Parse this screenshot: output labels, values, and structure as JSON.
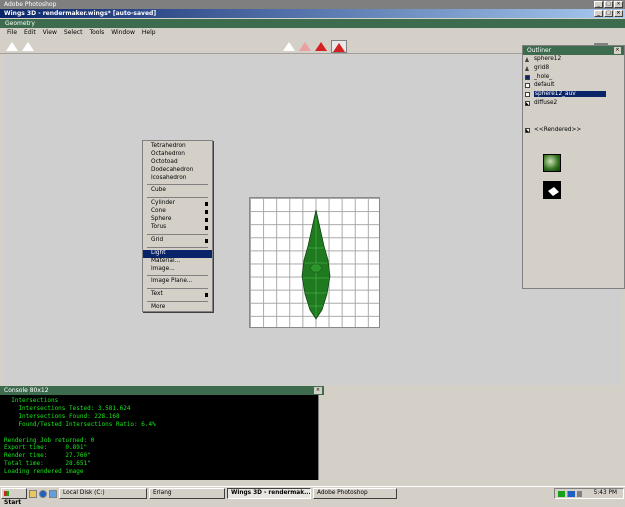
{
  "app_title": "Adobe Photoshop",
  "window_title": "Wings 3D - rendermaker.wings* [auto-saved]",
  "geometry_title": "Geometry",
  "menu": [
    "File",
    "Edit",
    "View",
    "Select",
    "Tools",
    "Window",
    "Help"
  ],
  "popup_menu": [
    {
      "label": "Tetrahedron"
    },
    {
      "label": "Octahedron"
    },
    {
      "label": "Octotoad"
    },
    {
      "label": "Dodecahedron"
    },
    {
      "label": "Icosahedron"
    },
    {
      "sep": true
    },
    {
      "label": "Cube"
    },
    {
      "sep": true
    },
    {
      "label": "Cylinder",
      "opt": true
    },
    {
      "label": "Cone",
      "opt": true
    },
    {
      "label": "Sphere",
      "opt": true
    },
    {
      "label": "Torus",
      "opt": true
    },
    {
      "sep": true
    },
    {
      "label": "Grid",
      "opt": true
    },
    {
      "sep": true
    },
    {
      "label": "Light",
      "selected": true
    },
    {
      "label": "Material..."
    },
    {
      "label": "Image..."
    },
    {
      "sep": true
    },
    {
      "label": "Image Plane..."
    },
    {
      "sep": true
    },
    {
      "label": "Text",
      "opt": true
    },
    {
      "sep": true
    },
    {
      "label": "More"
    }
  ],
  "outliner": {
    "title": "Outliner",
    "items": [
      {
        "label": "sphere12",
        "icon": "object-icon"
      },
      {
        "label": "grid8",
        "icon": "object-icon"
      },
      {
        "label": "_hole_",
        "icon": "material-icon",
        "color": "#0a246a"
      },
      {
        "label": "default",
        "icon": "material-icon"
      },
      {
        "label": "sphere12_auv",
        "icon": "material-icon",
        "selected": true
      },
      {
        "label": "diffuse2",
        "icon": "image-icon"
      },
      {
        "label": "<<Rendered>>",
        "icon": "image-icon"
      }
    ]
  },
  "console": {
    "title": "Console 80x12",
    "lines": [
      "  Intersections",
      "    Intersections Tested: 3.581.624",
      "    Intersections Found: 228.168",
      "    Found/Tested Intersections Ratio: 6.4%",
      "",
      "Rendering Job returned: 0",
      "Export time:     0.891\"",
      "Render time:     27.760\"",
      "Total time:      28.651\"",
      "Loading rendered image",
      "",
      "?"
    ]
  },
  "taskbar": {
    "start": "Start",
    "tasks": [
      "Local Disk (C:)",
      "Erlang",
      "Wings 3D - rendermak...",
      "Adobe Photoshop"
    ],
    "active_task": 2,
    "clock": "5:43 PM"
  },
  "colors": {
    "title_blue": "#0a246a",
    "panel_green": "#3c6b4e",
    "console_green": "#19e619",
    "model_green": "#1f7a1f",
    "toolbar_red": "#d42020"
  }
}
